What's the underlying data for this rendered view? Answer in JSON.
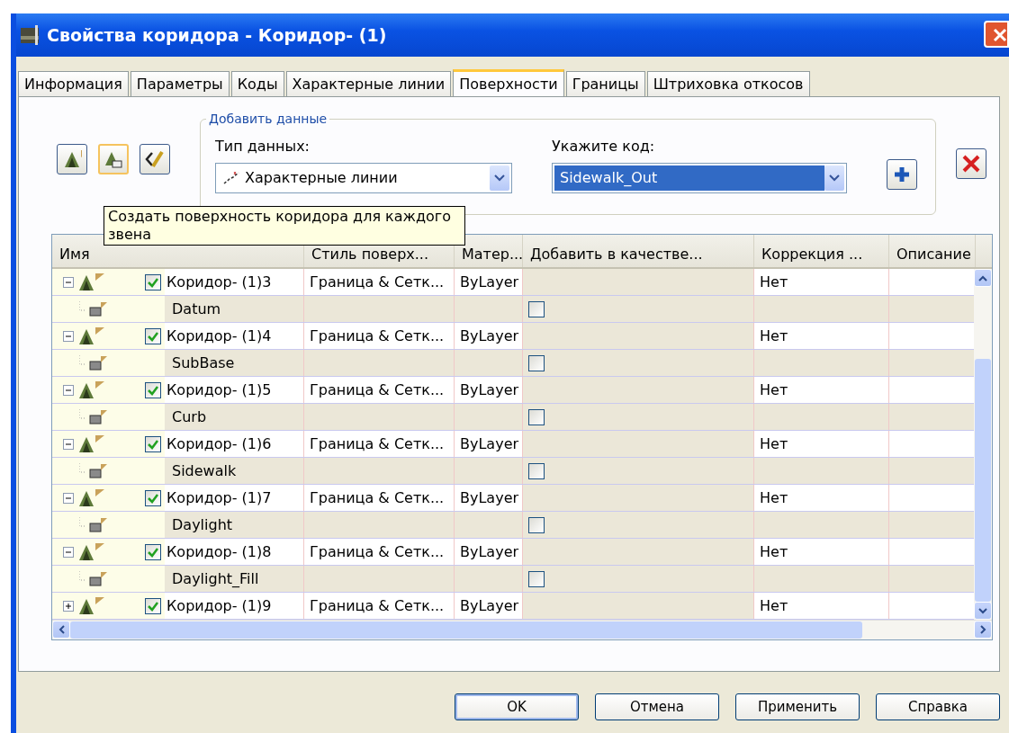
{
  "window": {
    "title": "Свойства коридора - Коридор- (1)"
  },
  "tabs": [
    {
      "label": "Информация",
      "selected": false
    },
    {
      "label": "Параметры",
      "selected": false
    },
    {
      "label": "Коды",
      "selected": false
    },
    {
      "label": "Характерные линии",
      "selected": false
    },
    {
      "label": "Поверхности",
      "selected": true
    },
    {
      "label": "Границы",
      "selected": false
    },
    {
      "label": "Штриховка откосов",
      "selected": false
    }
  ],
  "toolbar": [
    {
      "selected": false
    },
    {
      "selected": true
    },
    {
      "selected": false
    }
  ],
  "add_data": {
    "legend": "Добавить данные",
    "data_type": {
      "label": "Тип данных:",
      "value": "Характерные линии"
    },
    "code": {
      "label": "Укажите код:",
      "value": "Sidewalk_Out",
      "highlighted": true
    }
  },
  "tooltip": "Создать поверхность коридора для каждого звена",
  "table": {
    "columns": [
      "Имя",
      "Стиль поверх...",
      "Матер...",
      "Добавить в качестве...",
      "Коррекция ...",
      "Описание"
    ],
    "rows": [
      {
        "name": "Коридор- (1)3",
        "checked": true,
        "expanded": true,
        "style": "Граница & Сетк...",
        "material": "ByLayer",
        "correction": "Нет",
        "children": [
          {
            "name": "Datum",
            "checked": false
          }
        ]
      },
      {
        "name": "Коридор- (1)4",
        "checked": true,
        "expanded": true,
        "style": "Граница & Сетк...",
        "material": "ByLayer",
        "correction": "Нет",
        "children": [
          {
            "name": "SubBase",
            "checked": false
          }
        ]
      },
      {
        "name": "Коридор- (1)5",
        "checked": true,
        "expanded": true,
        "style": "Граница & Сетк...",
        "material": "ByLayer",
        "correction": "Нет",
        "children": [
          {
            "name": "Curb",
            "checked": false
          }
        ]
      },
      {
        "name": "Коридор- (1)6",
        "checked": true,
        "expanded": true,
        "style": "Граница & Сетк...",
        "material": "ByLayer",
        "correction": "Нет",
        "children": [
          {
            "name": "Sidewalk",
            "checked": false
          }
        ]
      },
      {
        "name": "Коридор- (1)7",
        "checked": true,
        "expanded": true,
        "style": "Граница & Сетк...",
        "material": "ByLayer",
        "correction": "Нет",
        "children": [
          {
            "name": "Daylight",
            "checked": false
          }
        ]
      },
      {
        "name": "Коридор- (1)8",
        "checked": true,
        "expanded": true,
        "style": "Граница & Сетк...",
        "material": "ByLayer",
        "correction": "Нет",
        "children": [
          {
            "name": "Daylight_Fill",
            "checked": false
          }
        ]
      },
      {
        "name": "Коридор- (1)9",
        "checked": true,
        "expanded": false,
        "style": "Граница & Сетк...",
        "material": "ByLayer",
        "correction": "Нет"
      }
    ]
  },
  "buttons": [
    {
      "label": "OK",
      "default": true
    },
    {
      "label": "Отмена",
      "default": false
    },
    {
      "label": "Применить",
      "default": false
    },
    {
      "label": "Справка",
      "default": false
    }
  ]
}
